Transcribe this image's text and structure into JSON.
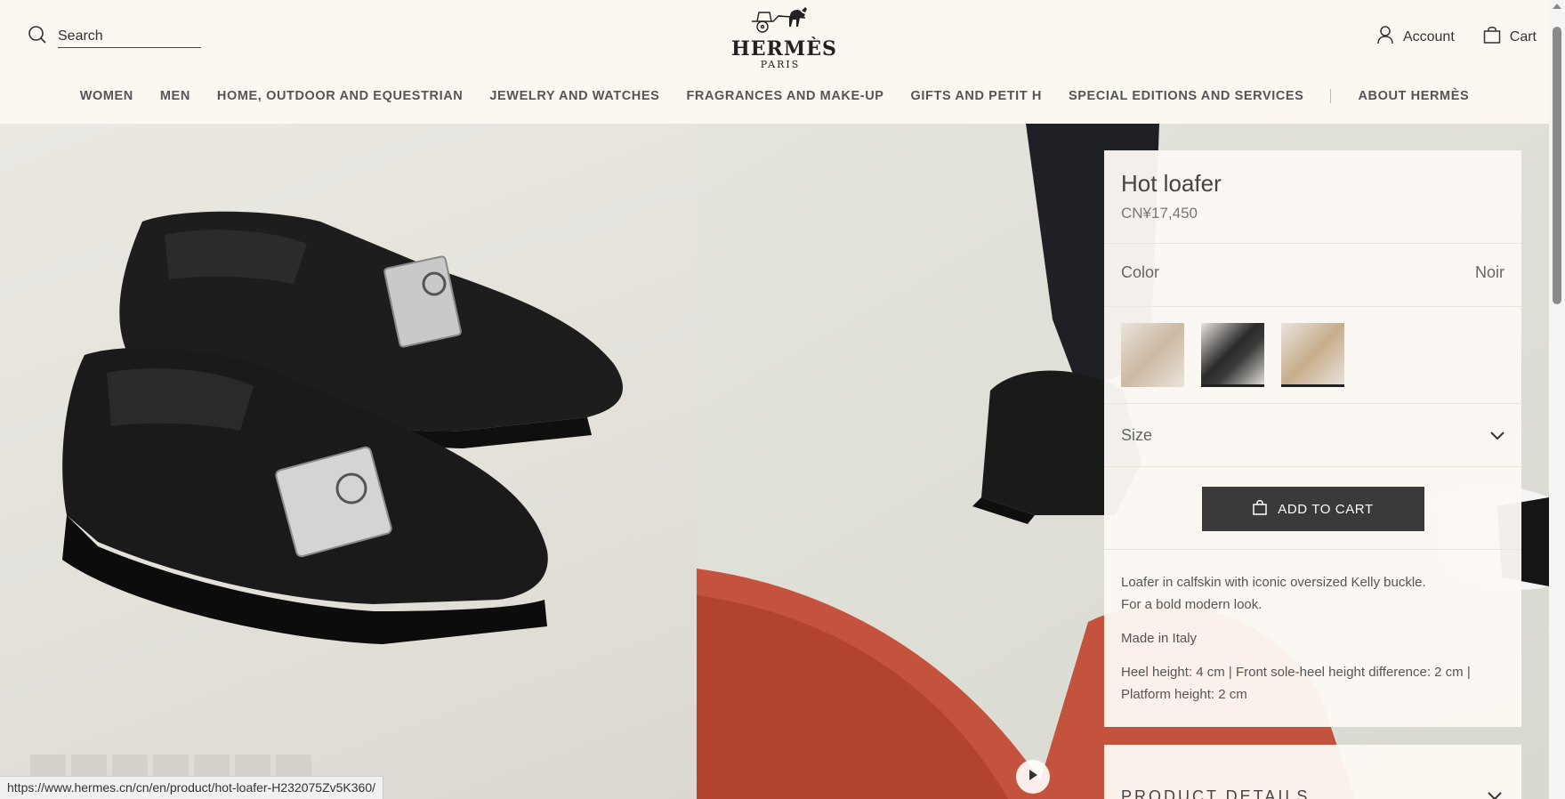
{
  "header": {
    "search_placeholder": "Search",
    "logo_word": "HERMÈS",
    "logo_sub": "PARIS",
    "account_label": "Account",
    "cart_label": "Cart"
  },
  "nav": {
    "items": [
      "WOMEN",
      "MEN",
      "HOME, OUTDOOR AND EQUESTRIAN",
      "JEWELRY AND WATCHES",
      "FRAGRANCES AND MAKE-UP",
      "GIFTS AND PETIT H",
      "SPECIAL EDITIONS AND SERVICES",
      "ABOUT HERMÈS"
    ]
  },
  "product": {
    "title": "Hot loafer",
    "price": "CN¥17,450",
    "color_label": "Color",
    "color_value": "Noir",
    "swatches": [
      "beige",
      "black",
      "tan"
    ],
    "size_label": "Size",
    "add_to_cart": "ADD TO CART",
    "description": [
      "Loafer in calfskin with iconic oversized Kelly buckle.\nFor a bold modern look.",
      "Made in Italy",
      "Heel height: 4 cm | Front sole-heel height difference: 2 cm | Platform height: 2 cm"
    ],
    "details_label": "PRODUCT DETAILS"
  },
  "status_url": "https://www.hermes.cn/cn/en/product/hot-loafer-H232075Zv5K360/",
  "colors": {
    "background": "#fcf7f1",
    "button": "#3a3a3a",
    "accent_red": "#c4533d"
  }
}
